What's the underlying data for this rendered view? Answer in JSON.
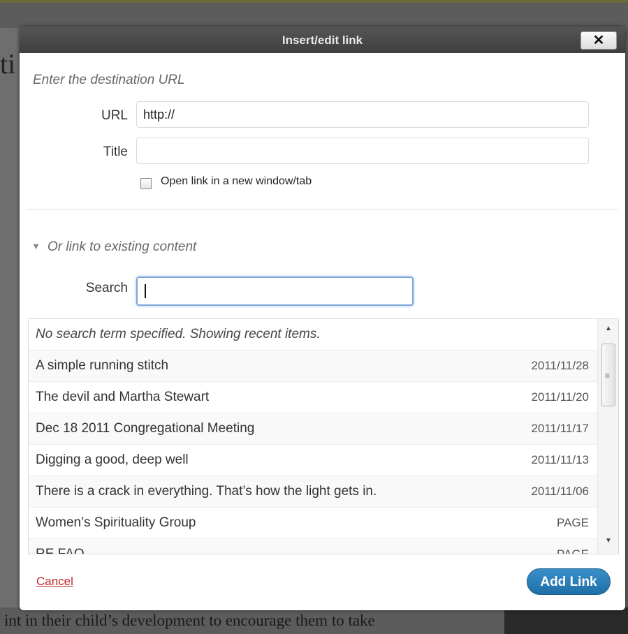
{
  "backdrop": {
    "title_fragment": "ti",
    "bottom_text": "int in their child’s development to encourage them to take"
  },
  "dialog": {
    "title": "Insert/edit link",
    "close_label": "✕"
  },
  "url_section": {
    "heading": "Enter the destination URL",
    "url_label": "URL",
    "url_value": "http://",
    "title_label": "Title",
    "title_value": "",
    "new_window_label": "Open link in a new window/tab",
    "new_window_checked": false
  },
  "existing_section": {
    "heading": "Or link to existing content",
    "search_label": "Search",
    "search_value": ""
  },
  "results": {
    "note": "No search term specified. Showing recent items.",
    "items": [
      {
        "title": "A simple running stitch",
        "info": "2011/11/28"
      },
      {
        "title": "The devil and Martha Stewart",
        "info": "2011/11/20"
      },
      {
        "title": "Dec 18 2011 Congregational Meeting",
        "info": "2011/11/17"
      },
      {
        "title": "Digging a good, deep well",
        "info": "2011/11/13"
      },
      {
        "title": "There is a crack in everything. That’s how the light gets in.",
        "info": "2011/11/06"
      },
      {
        "title": "Women’s Spirituality Group",
        "info": "PAGE"
      },
      {
        "title": "RE FAQ",
        "info": "PAGE"
      }
    ]
  },
  "footer": {
    "cancel_label": "Cancel",
    "submit_label": "Add Link"
  }
}
